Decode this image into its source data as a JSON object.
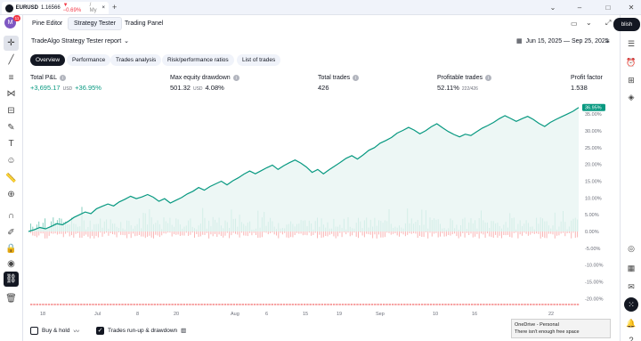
{
  "window": {
    "tab_symbol": "EURUSD",
    "tab_price": "1.16566",
    "tab_change": "▼ −0.69%",
    "tab_rest": "/ My",
    "plus": "+"
  },
  "top_tabs": [
    "Pine Editor",
    "Strategy Tester",
    "Trading Panel"
  ],
  "report": {
    "title": "TradeAlgo Strategy Tester report",
    "date_range": "Jun 15, 2025 — Sep 25, 2025"
  },
  "sub_tabs": [
    "Overview",
    "Performance",
    "Trades analysis",
    "Risk/performance ratios",
    "List of trades"
  ],
  "metrics": {
    "total_pnl": {
      "label": "Total P&L",
      "value": "+3,695.17",
      "unit": "USD",
      "pct": "+36.95%"
    },
    "max_dd": {
      "label": "Max equity drawdown",
      "value": "501.32",
      "unit": "USD",
      "pct": "4.08%"
    },
    "total_trades": {
      "label": "Total trades",
      "value": "426"
    },
    "profitable": {
      "label": "Profitable trades",
      "value": "52.11%",
      "sub": "222/426"
    },
    "profit_factor": {
      "label": "Profit factor",
      "value": "1.538"
    }
  },
  "right_toolbar": {
    "publish_label": "blish",
    "badge": "11"
  },
  "chart_data": {
    "type": "line",
    "y_ticks": [
      "35.00%",
      "30.00%",
      "25.00%",
      "20.00%",
      "15.00%",
      "10.00%",
      "5.00%",
      "0.00%",
      "-5.00%",
      "-10.00%",
      "-15.00%",
      "-20.00%"
    ],
    "ylim": [
      -22,
      37
    ],
    "x_ticks": [
      "18",
      "Jul",
      "8",
      "20",
      "Aug",
      "6",
      "15",
      "19",
      "Sep",
      "10",
      "16",
      "22"
    ],
    "last_value_label": "36.95%",
    "equity": [
      0,
      0.5,
      1.2,
      0.8,
      1.5,
      2.3,
      2.0,
      3.0,
      4.2,
      5.0,
      5.8,
      5.3,
      6.8,
      7.5,
      8.2,
      7.6,
      8.8,
      9.6,
      10.5,
      9.8,
      10.3,
      11.0,
      10.2,
      9.0,
      9.8,
      8.5,
      9.3,
      10.1,
      11.2,
      12.0,
      13.1,
      12.3,
      13.4,
      14.2,
      15.0,
      13.9,
      15.1,
      16.0,
      17.1,
      18.0,
      17.2,
      18.1,
      19.0,
      19.8,
      18.5,
      19.6,
      20.5,
      21.3,
      20.4,
      19.2,
      17.6,
      18.5,
      17.2,
      18.4,
      19.5,
      20.6,
      21.8,
      22.6,
      21.6,
      22.8,
      24.2,
      25.0,
      26.3,
      27.1,
      28.0,
      29.3,
      30.1,
      31.0,
      30.2,
      29.1,
      30.0,
      31.2,
      32.1,
      30.9,
      29.8,
      28.9,
      28.2,
      29.0,
      28.6,
      29.7,
      30.8,
      31.6,
      32.5,
      33.6,
      34.5,
      33.7,
      32.8,
      33.6,
      34.3,
      33.4,
      32.2,
      31.3,
      32.5,
      33.4,
      34.2,
      35.0,
      35.8,
      36.95
    ]
  },
  "bottom": {
    "buy_hold": "Buy & hold",
    "runup": "Trades run-up & drawdown",
    "toast_title": "OneDrive - Personal",
    "toast_body": "There isn't enough free space",
    "pct_btn": "centage"
  }
}
